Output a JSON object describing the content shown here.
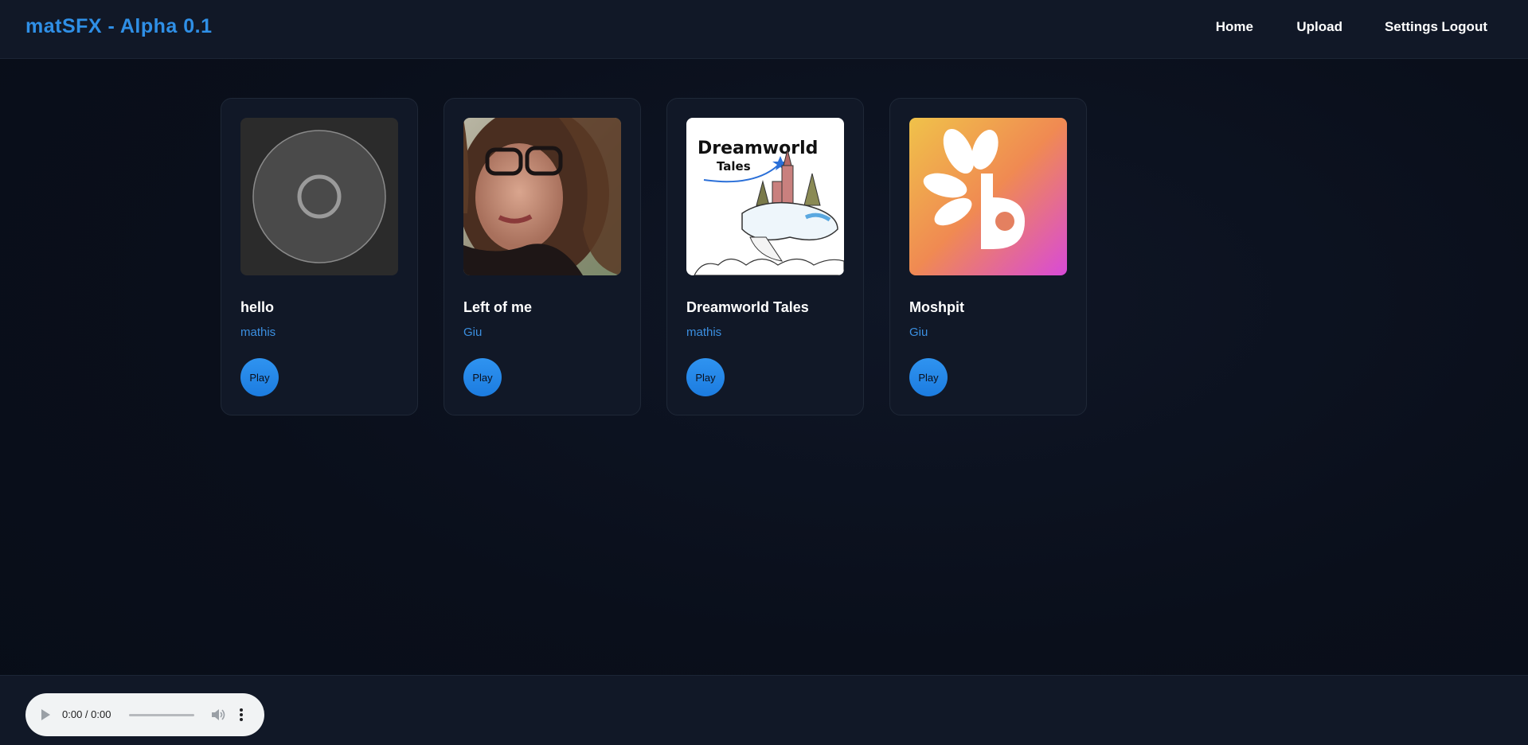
{
  "header": {
    "brand": "matSFX - Alpha 0.1",
    "nav": [
      "Home",
      "Upload",
      "Settings",
      "Logout"
    ]
  },
  "tracks": [
    {
      "title": "hello",
      "artist": "mathis",
      "play_label": "Play",
      "cover": "default-disc"
    },
    {
      "title": "Left of me",
      "artist": "Giu",
      "play_label": "Play",
      "cover": "portrait-photo"
    },
    {
      "title": "Dreamworld Tales",
      "artist": "mathis",
      "play_label": "Play",
      "cover": "dreamworld-tales-art",
      "cover_text": [
        "Dreamworld",
        "Tales"
      ]
    },
    {
      "title": "Moshpit",
      "artist": "Giu",
      "play_label": "Play",
      "cover": "bereal-style-logo"
    }
  ],
  "player": {
    "time": "0:00 / 0:00"
  },
  "colors": {
    "brand": "#2f8fe6",
    "accent": "#2f93f0",
    "artist_link": "#3b8fe0",
    "surface": "#111827",
    "background": "#0a0f1b"
  }
}
